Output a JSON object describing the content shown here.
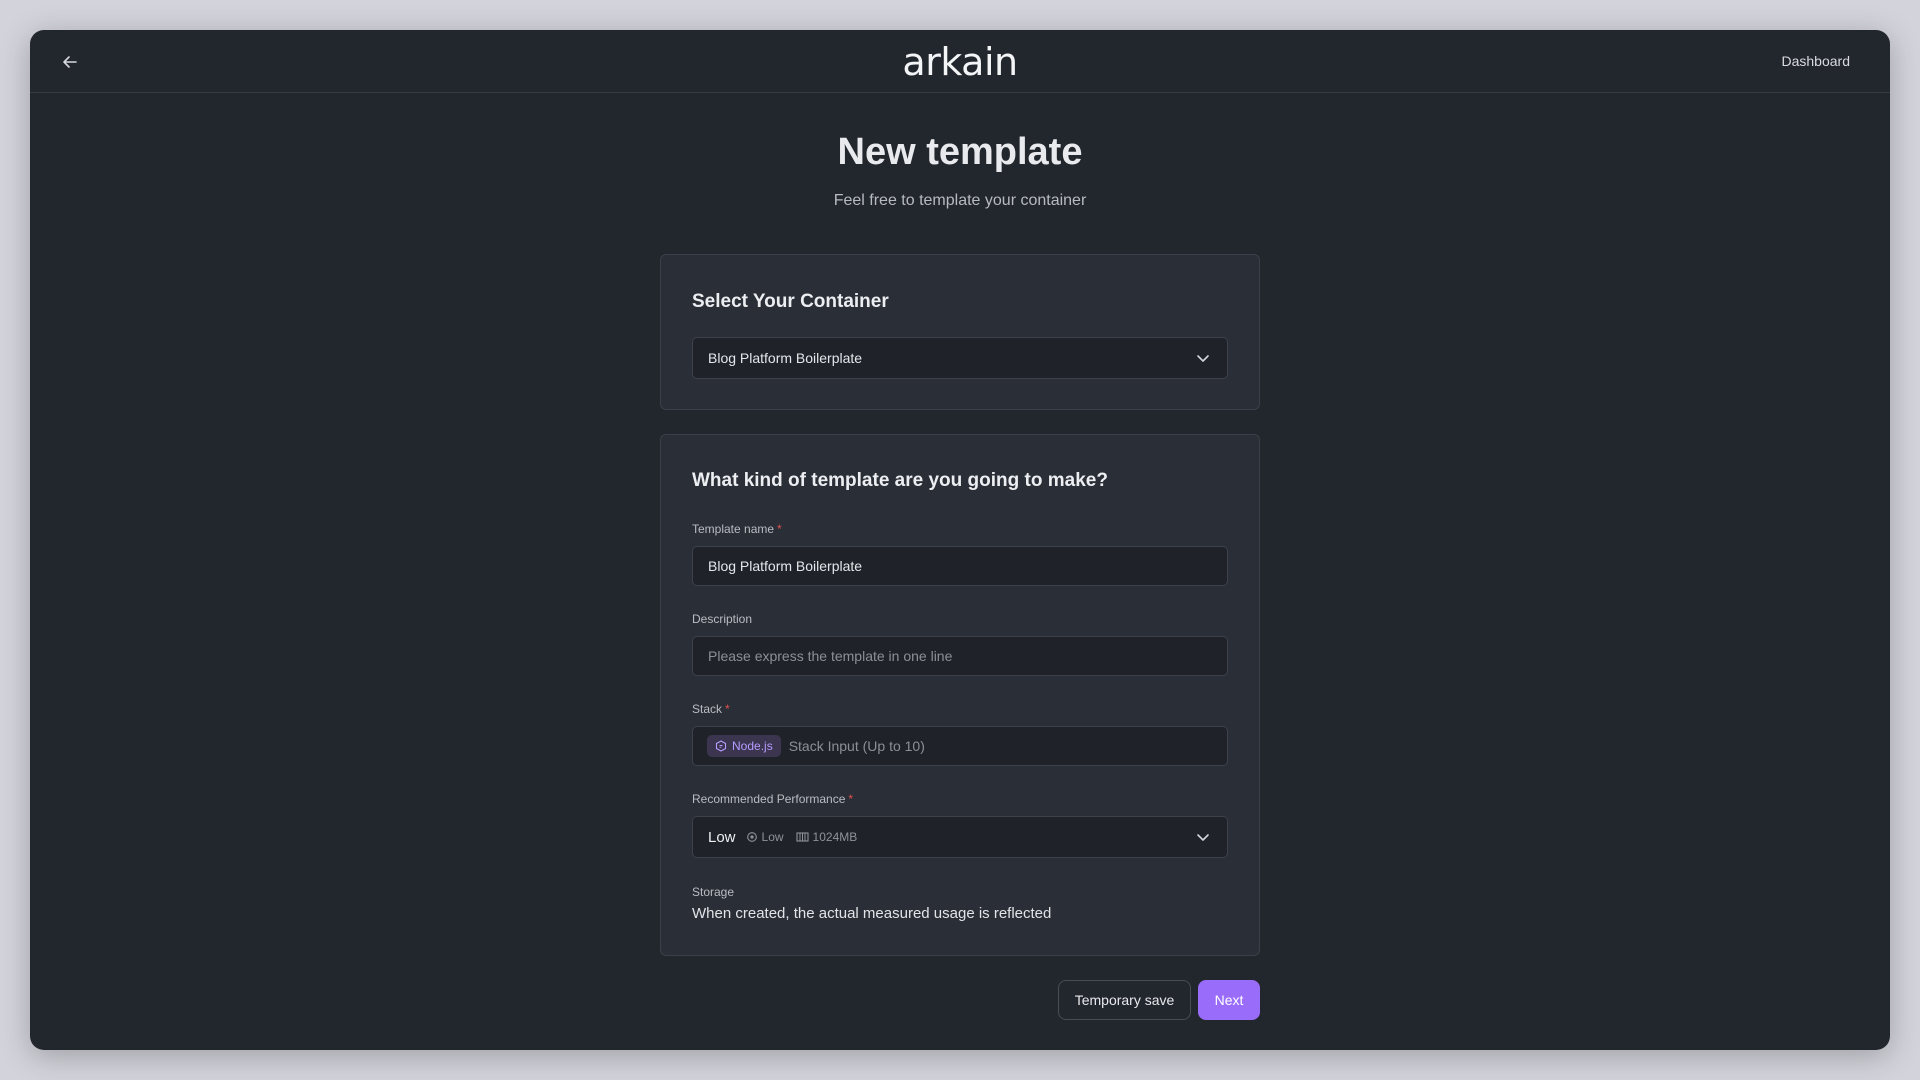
{
  "header": {
    "logo": "arkain",
    "dashboard_link": "Dashboard"
  },
  "page": {
    "title": "New template",
    "subtitle": "Feel free to template your container"
  },
  "container_card": {
    "title": "Select Your Container",
    "selected_container": "Blog Platform Boilerplate"
  },
  "template_card": {
    "title": "What kind of template are you going to make?",
    "name_label": "Template name",
    "name_value": "Blog Platform Boilerplate",
    "description_label": "Description",
    "description_placeholder": "Please express the template in one line",
    "stack_label": "Stack",
    "stack_chip": "Node.js",
    "stack_placeholder": "Stack Input (Up to 10)",
    "performance_label": "Recommended Performance",
    "performance_value": "Low",
    "performance_cpu": "Low",
    "performance_memory": "1024MB",
    "storage_label": "Storage",
    "storage_value": "When created, the actual measured usage is reflected",
    "required_marker": "*"
  },
  "actions": {
    "temporary_save": "Temporary save",
    "next": "Next"
  },
  "colors": {
    "accent": "#9a6cfa",
    "background": "#22262d",
    "card": "#2a2e36",
    "required": "#e05252"
  }
}
